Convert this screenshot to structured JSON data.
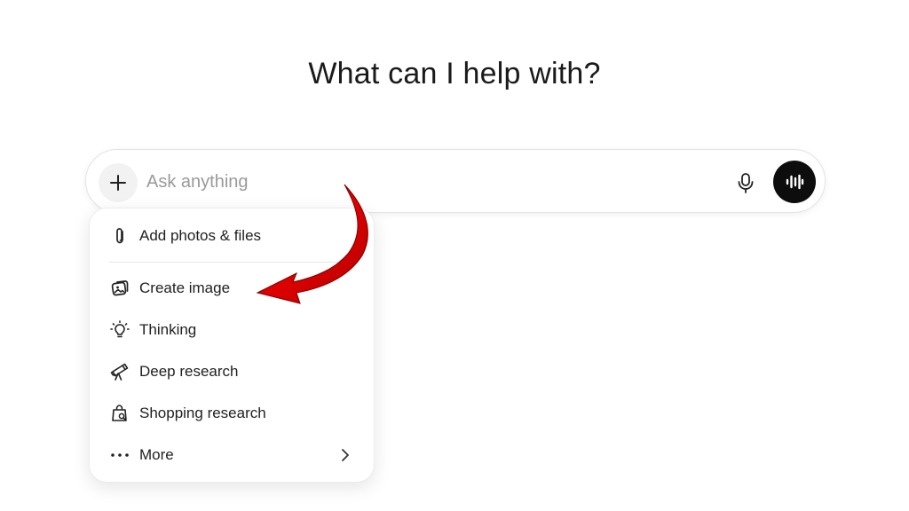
{
  "heading": "What can I help with?",
  "composer": {
    "placeholder": "Ask anything",
    "plus_icon": "plus-icon",
    "mic_icon": "microphone-icon",
    "voice_icon": "voice-waveform-icon"
  },
  "menu": {
    "items": [
      {
        "label": "Add photos & files",
        "icon": "paperclip-icon"
      },
      {
        "label": "Create image",
        "icon": "image-icon"
      },
      {
        "label": "Thinking",
        "icon": "lightbulb-icon"
      },
      {
        "label": "Deep research",
        "icon": "telescope-icon"
      },
      {
        "label": "Shopping research",
        "icon": "shopping-bag-icon"
      },
      {
        "label": "More",
        "icon": "ellipsis-icon"
      }
    ],
    "more_chevron_icon": "chevron-right-icon"
  },
  "annotation": {
    "arrow_color": "#d40000"
  },
  "colors": {
    "voice_button_bg": "#0d0d0d",
    "plus_button_bg": "#f2f2f2"
  }
}
